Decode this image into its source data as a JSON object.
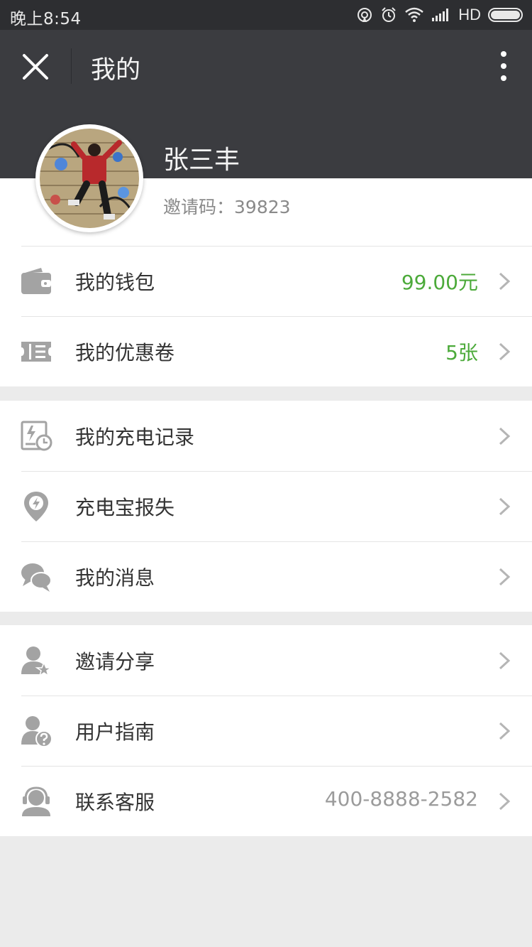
{
  "status": {
    "time": "晚上8:54",
    "network": "HD"
  },
  "nav": {
    "title": "我的"
  },
  "profile": {
    "name": "张三丰",
    "invite_label": "邀请码：",
    "invite_code": "39823"
  },
  "groups": [
    {
      "items": [
        {
          "label": "我的钱包",
          "value": "99.00元",
          "value_color": "#4caa3a",
          "icon": "wallet-icon"
        },
        {
          "label": "我的优惠卷",
          "value": "5张",
          "value_color": "#4caa3a",
          "icon": "coupon-icon"
        }
      ]
    },
    {
      "items": [
        {
          "label": "我的充电记录",
          "icon": "charge-record-icon"
        },
        {
          "label": "充电宝报失",
          "icon": "location-lightning-icon"
        },
        {
          "label": "我的消息",
          "icon": "chat-bubbles-icon"
        }
      ]
    },
    {
      "items": [
        {
          "label": "邀请分享",
          "icon": "user-star-icon"
        },
        {
          "label": "用户指南",
          "icon": "user-help-icon"
        },
        {
          "label": "联系客服",
          "value": "400-8888-2582",
          "value_color": "#9b9b9b",
          "icon": "headset-icon"
        }
      ]
    }
  ]
}
